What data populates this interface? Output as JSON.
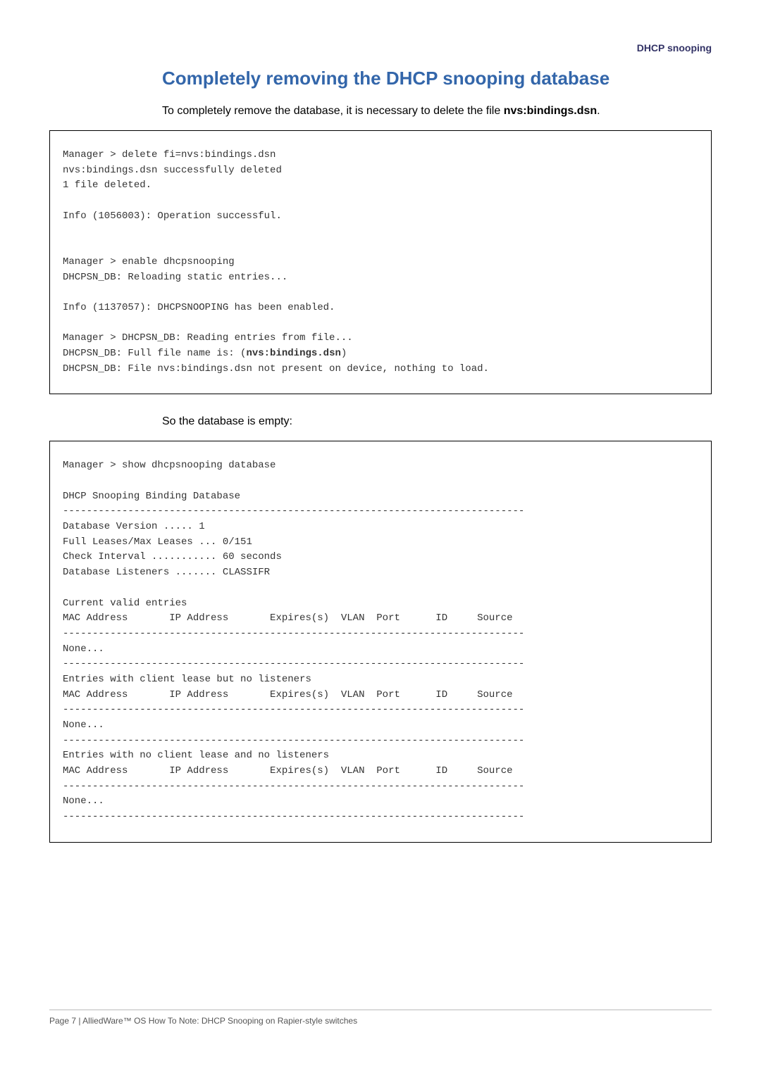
{
  "header": {
    "topRight": "DHCP snooping"
  },
  "section": {
    "title": "Completely removing the DHCP snooping database",
    "introPrefix": "To completely remove the database, it is necessary to delete the file ",
    "introBold": "nvs:bindings.dsn",
    "introSuffix": "."
  },
  "codeBlock1": {
    "l1": "Manager > delete fi=nvs:bindings.dsn",
    "l2": "nvs:bindings.dsn successfully deleted",
    "l3": "1 file deleted.",
    "l4": "",
    "l5": "Info (1056003): Operation successful.",
    "l6": "",
    "l7": "",
    "l8": "Manager > enable dhcpsnooping",
    "l9": "DHCPSN_DB: Reloading static entries...",
    "l10": "",
    "l11": "Info (1137057): DHCPSNOOPING has been enabled.",
    "l12": "",
    "l13": "Manager > DHCPSN_DB: Reading entries from file...",
    "l14a": "DHCPSN_DB: Full file name is: (",
    "l14b": "nvs:bindings.dsn",
    "l14c": ")",
    "l15": "DHCPSN_DB: File nvs:bindings.dsn not present on device, nothing to load."
  },
  "midText": "So the database is empty:",
  "codeBlock2": {
    "l1": "Manager > show dhcpsnooping database",
    "l2": "",
    "l3": "DHCP Snooping Binding Database",
    "l4": "------------------------------------------------------------------------------",
    "l5": "Database Version ..... 1",
    "l6": "Full Leases/Max Leases ... 0/151",
    "l7": "Check Interval ........... 60 seconds",
    "l8": "Database Listeners ....... CLASSIFR",
    "l9": "",
    "l10": "Current valid entries",
    "l11": "MAC Address       IP Address       Expires(s)  VLAN  Port      ID     Source",
    "l12": "------------------------------------------------------------------------------",
    "l13": "None...",
    "l14": "------------------------------------------------------------------------------",
    "l15": "Entries with client lease but no listeners",
    "l16": "MAC Address       IP Address       Expires(s)  VLAN  Port      ID     Source",
    "l17": "------------------------------------------------------------------------------",
    "l18": "None...",
    "l19": "------------------------------------------------------------------------------",
    "l20": "Entries with no client lease and no listeners",
    "l21": "MAC Address       IP Address       Expires(s)  VLAN  Port      ID     Source",
    "l22": "------------------------------------------------------------------------------",
    "l23": "None...",
    "l24": "------------------------------------------------------------------------------"
  },
  "footer": {
    "text": "Page 7 | AlliedWare™ OS How To Note: DHCP Snooping on Rapier-style switches"
  }
}
